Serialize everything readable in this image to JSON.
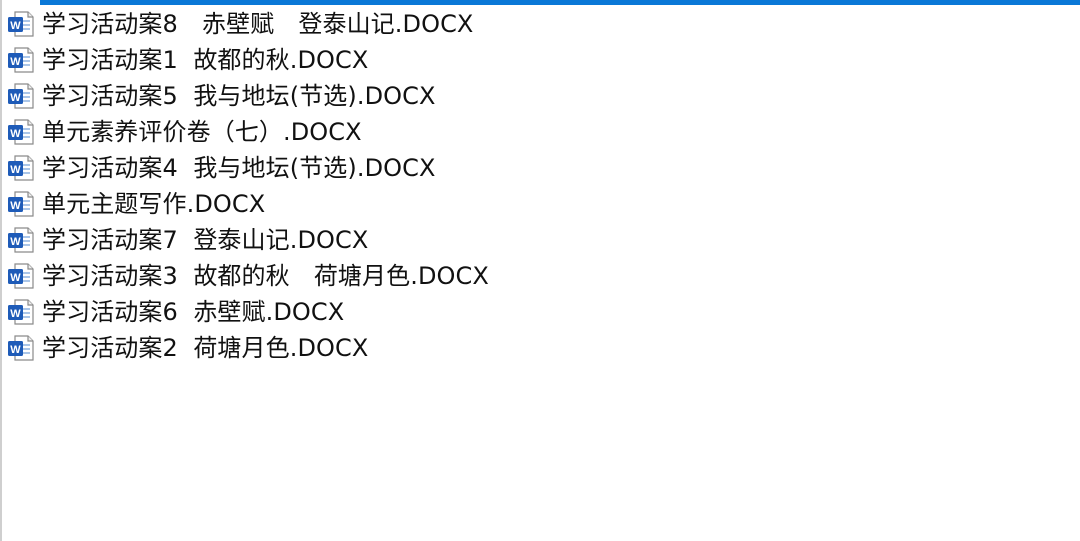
{
  "colors": {
    "accent": "#0a78d7",
    "word_icon_blue": "#1e5bb8",
    "text": "#111111",
    "background": "#ffffff"
  },
  "file_icon": "word-document-icon",
  "files": [
    {
      "name": "学习活动案8　赤壁赋　登泰山记.DOCX"
    },
    {
      "name": "学习活动案1  故都的秋.DOCX"
    },
    {
      "name": "学习活动案5  我与地坛(节选).DOCX"
    },
    {
      "name": "单元素养评价卷（七）.DOCX"
    },
    {
      "name": "学习活动案4  我与地坛(节选).DOCX"
    },
    {
      "name": "单元主题写作.DOCX"
    },
    {
      "name": "学习活动案7  登泰山记.DOCX"
    },
    {
      "name": "学习活动案3  故都的秋　荷塘月色.DOCX"
    },
    {
      "name": "学习活动案6  赤壁赋.DOCX"
    },
    {
      "name": "学习活动案2  荷塘月色.DOCX"
    }
  ]
}
